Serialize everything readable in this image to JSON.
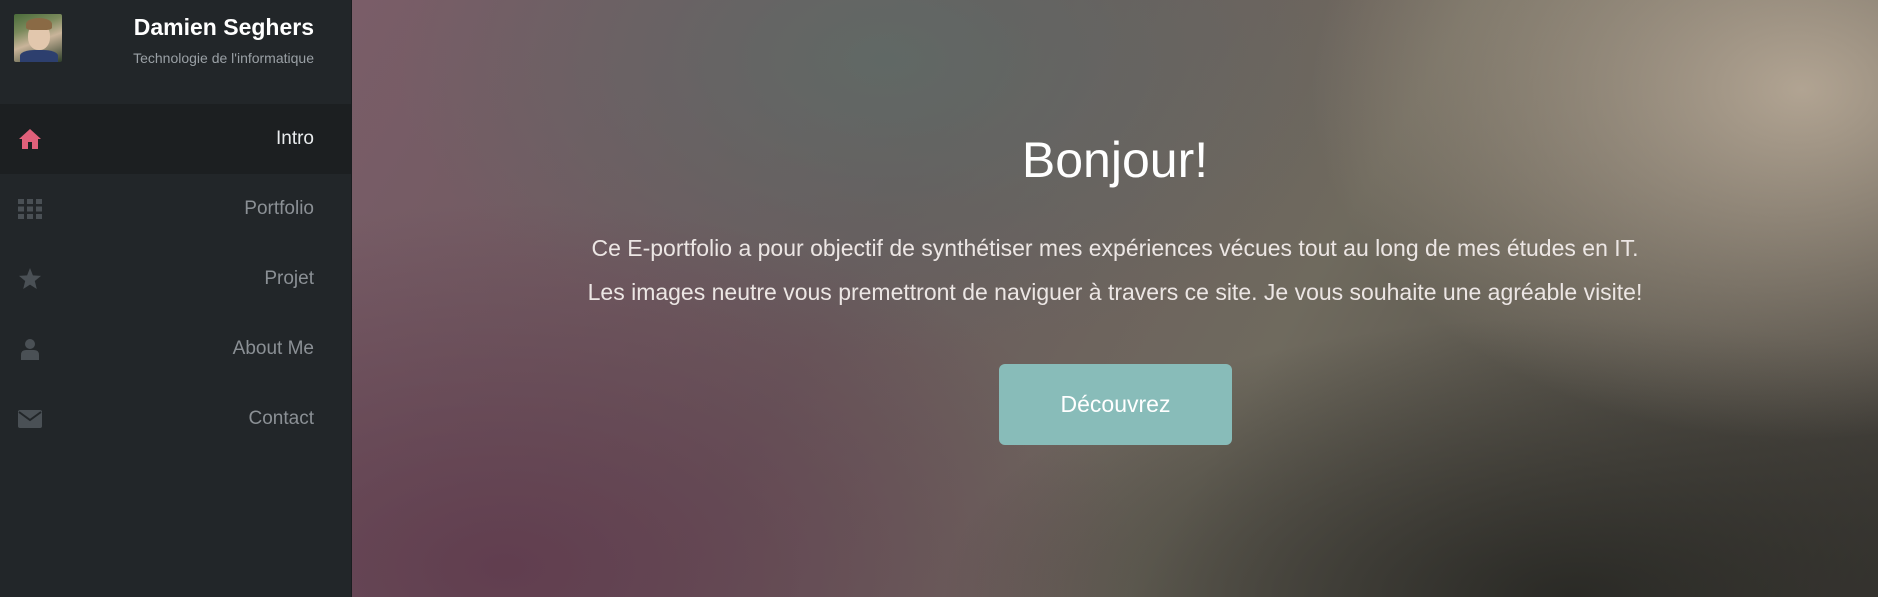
{
  "profile": {
    "name": "Damien Seghers",
    "subtitle": "Technologie de l'informatique"
  },
  "nav": {
    "items": [
      {
        "label": "Intro",
        "icon": "home-icon",
        "active": true
      },
      {
        "label": "Portfolio",
        "icon": "grid-icon",
        "active": false
      },
      {
        "label": "Projet",
        "icon": "star-icon",
        "active": false
      },
      {
        "label": "About Me",
        "icon": "user-icon",
        "active": false
      },
      {
        "label": "Contact",
        "icon": "envelope-icon",
        "active": false
      }
    ],
    "active_icon_color": "#e0607a",
    "icon_color": "#4a5055"
  },
  "hero": {
    "title": "Bonjour!",
    "line1": "Ce E-portfolio a pour objectif de synthétiser mes expériences vécues tout au long de mes études en IT.",
    "line2": "Les images neutre vous premettront de naviguer à travers ce site. Je vous souhaite une agréable visite!",
    "cta_label": "Découvrez",
    "cta_color": "#88bcb9"
  }
}
